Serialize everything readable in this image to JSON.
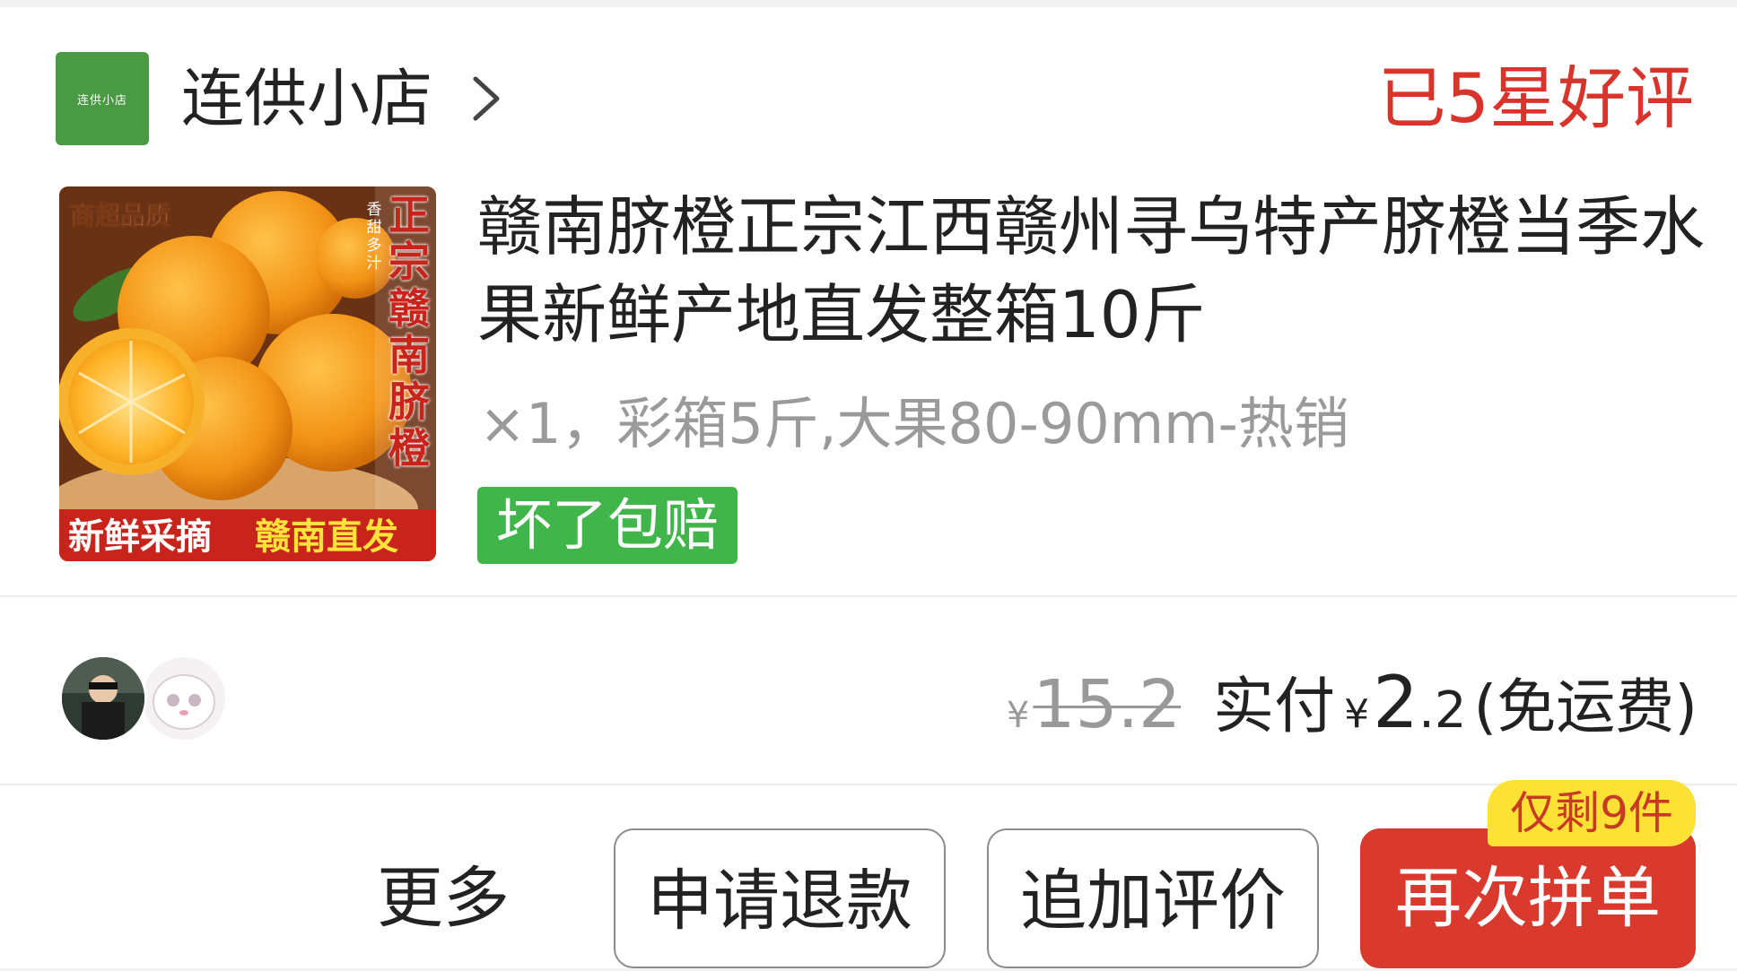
{
  "store": {
    "logo_text": "连供小店",
    "name": "连供小店",
    "chevron_icon": "chevron-right-icon",
    "review_status": "已5星好评"
  },
  "product": {
    "image": {
      "badge_top_left": "商超品质",
      "vertical_title": "正宗赣南脐橙",
      "side_small": "香甜多汁",
      "banner_left": "新鲜采摘",
      "banner_right": "赣南直发",
      "colors": {
        "orange": "#f39a1c",
        "banner": "#c8241c",
        "banner_yellow": "#ffe23a"
      }
    },
    "title": "赣南脐橙正宗江西赣州寻乌特产脐橙当季水果新鲜产地直发整箱10斤",
    "spec": "×1，彩箱5斤,大果80-90mm-热销",
    "guarantee_badge": "坏了包赔"
  },
  "price": {
    "yen_symbol": "¥",
    "original": "15.2",
    "paid_label": "实付",
    "paid_yen": "¥",
    "paid_integer": "2",
    "paid_decimal": ".2",
    "shipping_note": "(免运费)"
  },
  "actions": {
    "more": "更多",
    "refund": "申请退款",
    "add_review": "追加评价",
    "reorder": "再次拼单",
    "stock_badge": "仅剩9件"
  },
  "colors": {
    "accent_red": "#da3a2e",
    "review_red": "#d9342b",
    "badge_green": "#3fb54a",
    "stock_yellow": "#fbe234",
    "store_green": "#4a9a44"
  }
}
